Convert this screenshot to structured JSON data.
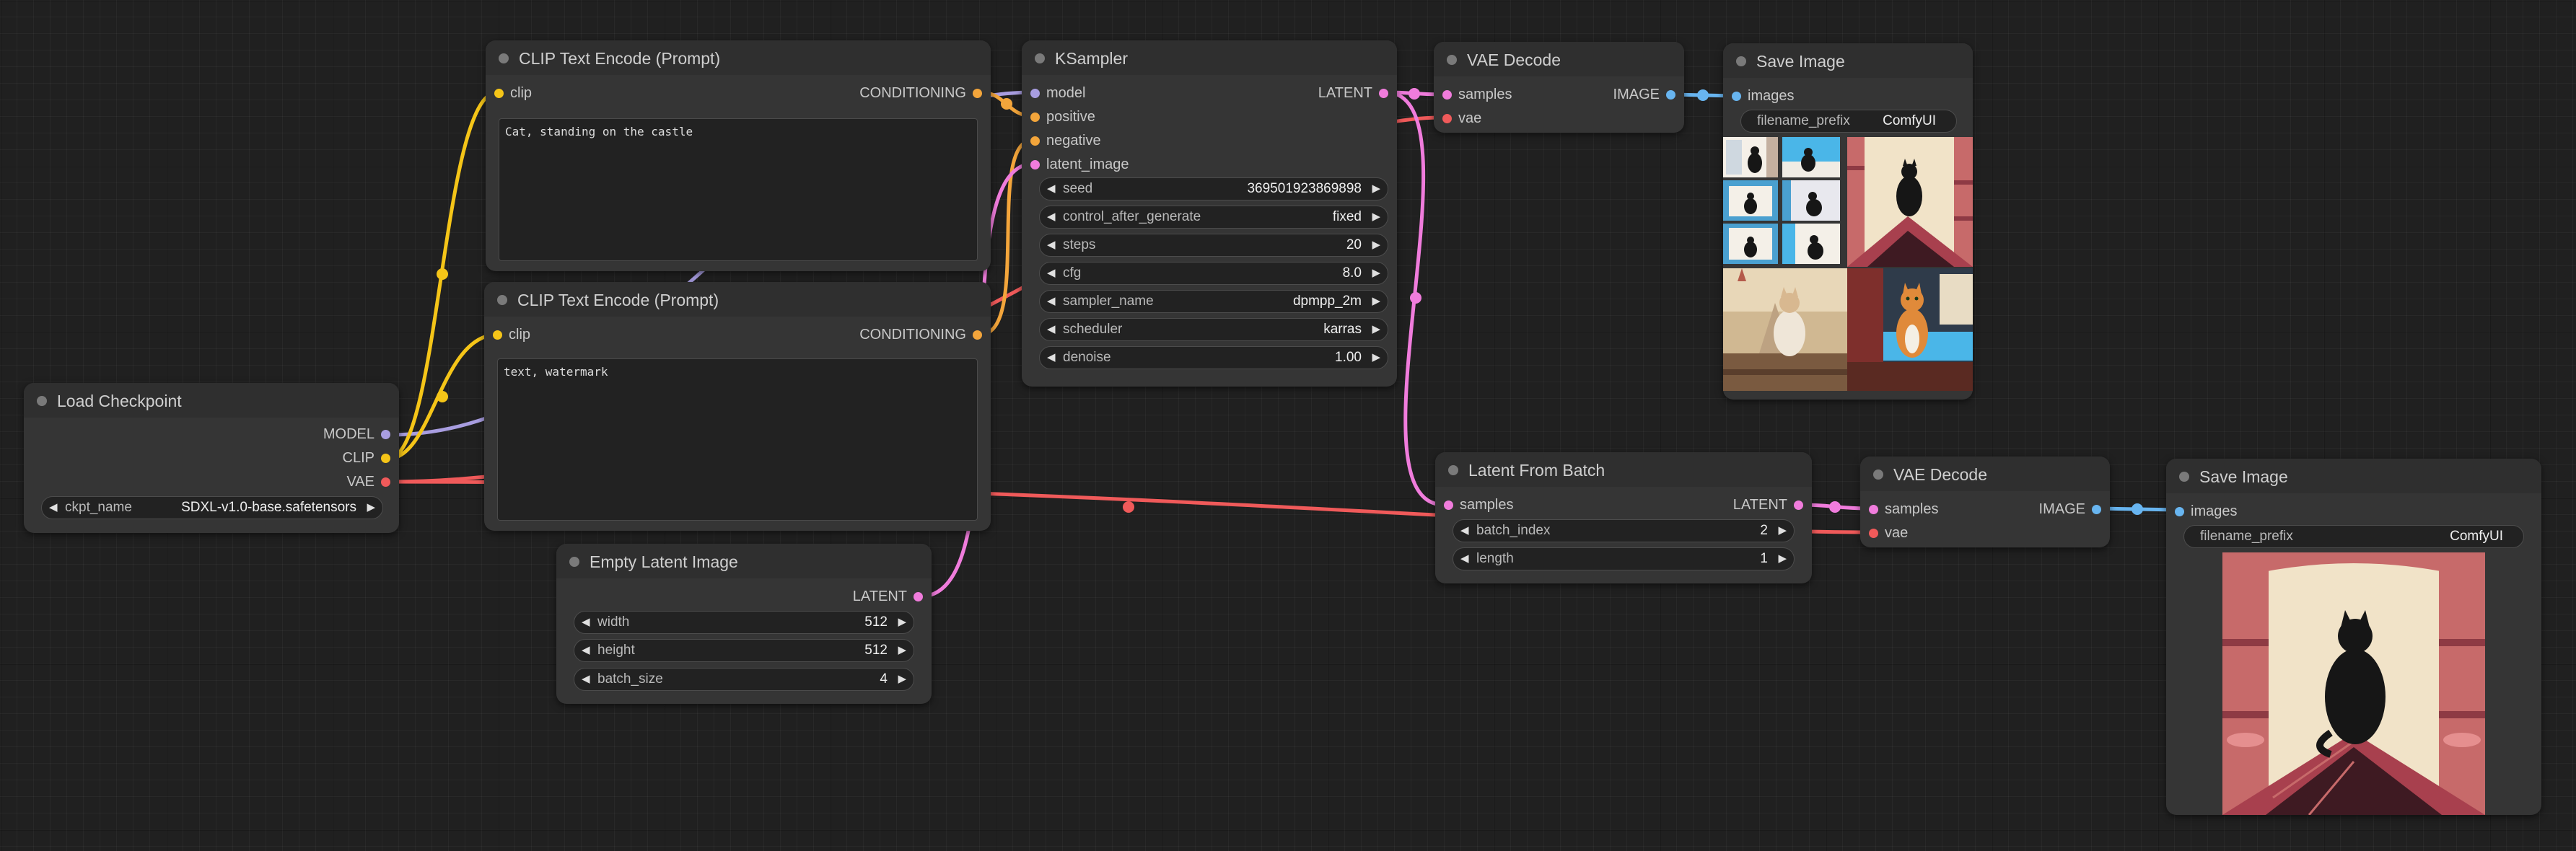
{
  "app": "ComfyUI",
  "colors": {
    "model": "#a89de0",
    "clip": "#f5c518",
    "vae": "#f05a5a",
    "conditioning": "#f3a53b",
    "latent": "#f07cdc",
    "image": "#68b5f0",
    "node_bg": "#353535",
    "canvas_bg": "#202020"
  },
  "nodes": {
    "load_checkpoint": {
      "title": "Load Checkpoint",
      "outputs": {
        "model": "MODEL",
        "clip": "CLIP",
        "vae": "VAE"
      },
      "widgets": {
        "ckpt_name": {
          "label": "ckpt_name",
          "value": "SDXL-v1.0-base.safetensors"
        }
      }
    },
    "clip_pos": {
      "title": "CLIP Text Encode (Prompt)",
      "inputs": {
        "clip": "clip"
      },
      "outputs": {
        "conditioning": "CONDITIONING"
      },
      "text": "Cat, standing on the castle"
    },
    "clip_neg": {
      "title": "CLIP Text Encode (Prompt)",
      "inputs": {
        "clip": "clip"
      },
      "outputs": {
        "conditioning": "CONDITIONING"
      },
      "text": "text, watermark"
    },
    "empty_latent": {
      "title": "Empty Latent Image",
      "outputs": {
        "latent": "LATENT"
      },
      "widgets": {
        "width": {
          "label": "width",
          "value": "512"
        },
        "height": {
          "label": "height",
          "value": "512"
        },
        "batch_size": {
          "label": "batch_size",
          "value": "4"
        }
      }
    },
    "ksampler": {
      "title": "KSampler",
      "inputs": {
        "model": "model",
        "positive": "positive",
        "negative": "negative",
        "latent_image": "latent_image"
      },
      "outputs": {
        "latent": "LATENT"
      },
      "widgets": {
        "seed": {
          "label": "seed",
          "value": "369501923869898"
        },
        "control_after_generate": {
          "label": "control_after_generate",
          "value": "fixed"
        },
        "steps": {
          "label": "steps",
          "value": "20"
        },
        "cfg": {
          "label": "cfg",
          "value": "8.0"
        },
        "sampler_name": {
          "label": "sampler_name",
          "value": "dpmpp_2m"
        },
        "scheduler": {
          "label": "scheduler",
          "value": "karras"
        },
        "denoise": {
          "label": "denoise",
          "value": "1.00"
        }
      }
    },
    "vae_decode_1": {
      "title": "VAE Decode",
      "inputs": {
        "samples": "samples",
        "vae": "vae"
      },
      "outputs": {
        "image": "IMAGE"
      }
    },
    "save_image_1": {
      "title": "Save Image",
      "inputs": {
        "images": "images"
      },
      "widgets": {
        "filename_prefix": {
          "label": "filename_prefix",
          "value": "ComfyUI"
        }
      }
    },
    "latent_from_batch": {
      "title": "Latent From Batch",
      "inputs": {
        "samples": "samples"
      },
      "outputs": {
        "latent": "LATENT"
      },
      "widgets": {
        "batch_index": {
          "label": "batch_index",
          "value": "2"
        },
        "length": {
          "label": "length",
          "value": "1"
        }
      }
    },
    "vae_decode_2": {
      "title": "VAE Decode",
      "inputs": {
        "samples": "samples",
        "vae": "vae"
      },
      "outputs": {
        "image": "IMAGE"
      }
    },
    "save_image_2": {
      "title": "Save Image",
      "inputs": {
        "images": "images"
      },
      "widgets": {
        "filename_prefix": {
          "label": "filename_prefix",
          "value": "ComfyUI"
        }
      }
    }
  }
}
